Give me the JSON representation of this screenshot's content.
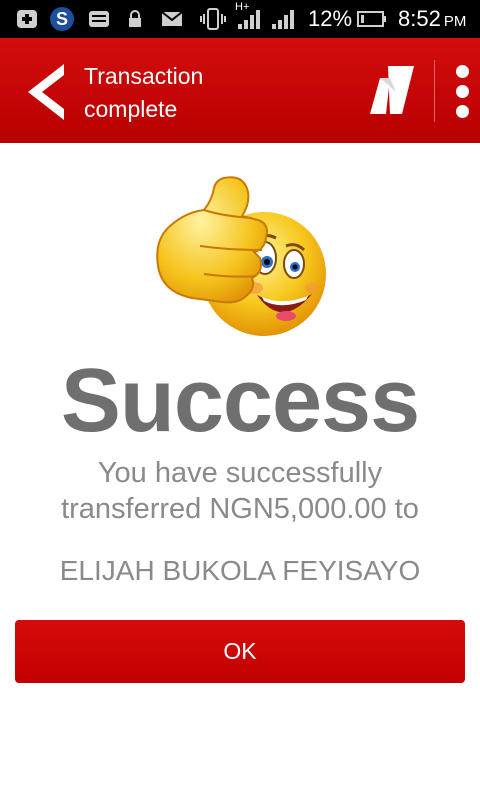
{
  "status_bar": {
    "battery_percent_text": "12%",
    "time": "8:52",
    "time_suffix": "PM",
    "network_label": "H+",
    "icons": [
      "add-box-icon",
      "s-app-icon",
      "storage-icon",
      "lock-icon",
      "mail-icon",
      "vibrate-icon",
      "signal-icon",
      "signal-icon",
      "battery-icon"
    ]
  },
  "header": {
    "title_line1": "Transaction",
    "title_line2": "complete",
    "back_icon": "chevron-left-icon",
    "logo_icon": "brand-logo-icon",
    "menu_icon": "more-vertical-icon"
  },
  "content": {
    "heading": "Success",
    "message_line1": "You have successfully",
    "message_line2": "transferred NGN5,000.00 to",
    "recipient": "ELIJAH BUKOLA FEYISAYO",
    "illustration": "thumbs-up-smiley-icon"
  },
  "actions": {
    "ok_label": "OK"
  },
  "colors": {
    "brand_red": "#c80000",
    "text_gray": "#6f6f6f",
    "status_bar": "#000000"
  }
}
